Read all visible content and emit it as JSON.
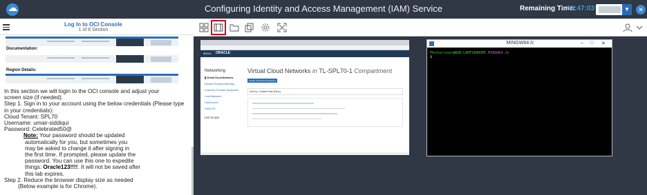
{
  "header": {
    "title": "Configuring Identity and Access Management (IAM) Service",
    "remaining_label": "Remaining Time:",
    "timer": "00:47:03"
  },
  "colors": {
    "topbar": "#2f3844",
    "accent": "#2e9bdc",
    "link": "#2a6ebb",
    "highlight": "#d0021b"
  },
  "lab_panel": {
    "section_title": "Log In to OCI Console",
    "section_counter": "1 of 8 Section",
    "documentation_label": "Documentation:",
    "region_label": "Region Details:",
    "lines": [
      "In this section we will login to the OCI console and adjust your",
      "screen size (if needed).",
      "Step 1. Sign in to your account using the below credentials (Please type",
      "in your credentials):",
      "Cloud Tenant: SPL70",
      "Username: umair-siddiqui",
      "Password: Celebrated50@"
    ],
    "note": {
      "label": "Note:",
      "line1": " Your password should be updated",
      "lines": [
        "automatically for you, but sometimes you",
        "may be asked to change it after signing in",
        "the first time. If prompted, please update the",
        "password. You can use this one to expedite"
      ],
      "things_prefix": "things: ",
      "new_password": "Oracle123!!!!",
      "things_suffix": ". It will not be saved after",
      "last_line": "this lab expires."
    },
    "step2": "Step 2. Reduce the browser display size  as needed",
    "step2_sub": "(Below example is for Chrome)."
  },
  "toolbar": {
    "icons": [
      "grid-icon",
      "split-view-icon",
      "folder-icon",
      "copy-icon",
      "settings-icon",
      "fullscreen-icon"
    ],
    "active": "split-view-icon"
  },
  "browser": {
    "menu": "MENU",
    "brand": "ORACLE",
    "nav_heading": "Networking",
    "nav_items": [
      "Virtual Cloud Networks",
      "Dynamic Routing Gateways",
      "Customer-Premises Equipment",
      "Load Balancers",
      "FastConnect",
      "Public IPs"
    ],
    "list_scope": "List Scope",
    "page_title": "Virtual Cloud Networks",
    "page_title_in": "in",
    "compartment": "TL-SPL70-1",
    "compartment_suffix": "Compartment",
    "create_button": "Create Virtual Cloud Network",
    "sort_label": "Sort by:",
    "sort_value": "Created Date (Desc)"
  },
  "terminal": {
    "title": "MINGW64:/c",
    "user": "Photon!user@WIN-L0RF10AHSMI",
    "shell": "MINGW64",
    "path": "/c",
    "prompt": "$"
  }
}
